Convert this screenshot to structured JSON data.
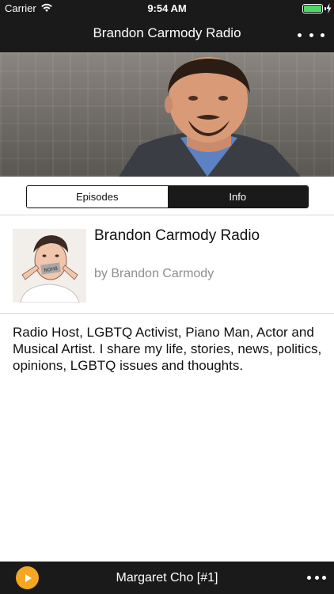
{
  "status_bar": {
    "carrier": "Carrier",
    "time": "9:54 AM",
    "wifi_icon": "wifi-icon",
    "battery_icon": "battery-full-icon",
    "battery_color": "#4cd964"
  },
  "nav": {
    "title": "Brandon Carmody Radio",
    "more_icon": "more-horizontal-icon"
  },
  "segments": {
    "episodes_label": "Episodes",
    "info_label": "Info",
    "selected": "Info"
  },
  "podcast": {
    "title": "Brandon Carmody Radio",
    "author": "by Brandon Carmody",
    "description": "Radio Host, LGBTQ Activist, Piano Man, Actor and Musical Artist. I share my life, stories, news, politics, opinions, LGBTQ issues and thoughts."
  },
  "player": {
    "now_playing": "Margaret Cho [#1]",
    "play_icon": "play-icon",
    "accent_color": "#f5a623",
    "more_icon": "more-horizontal-icon"
  }
}
